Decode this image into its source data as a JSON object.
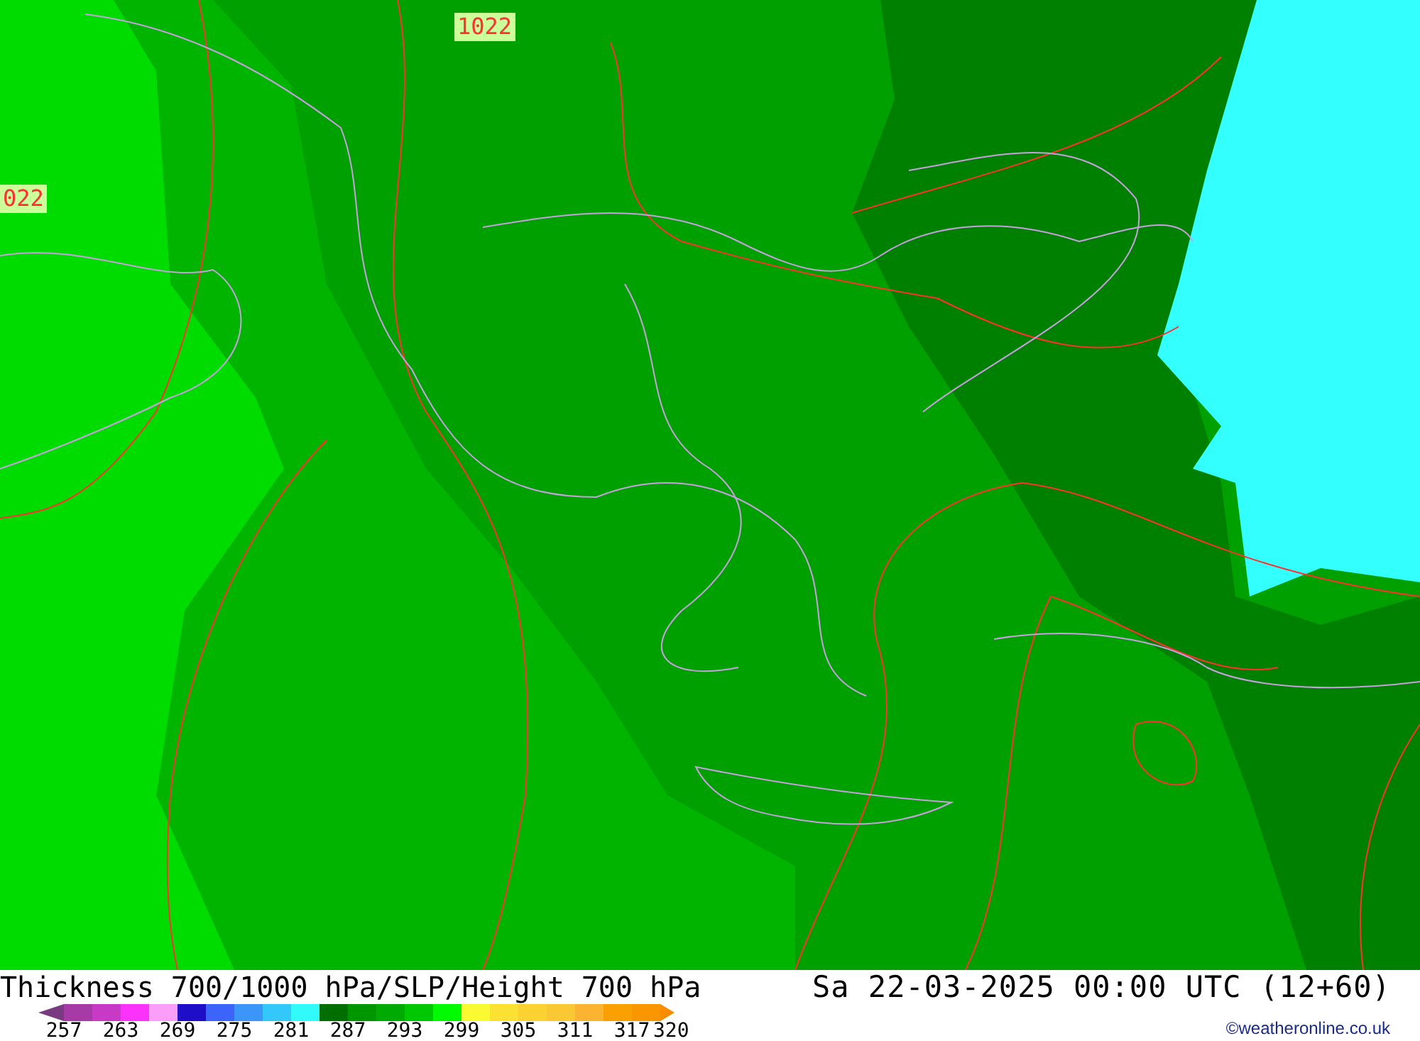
{
  "map": {
    "labels": [
      "1022",
      "022"
    ]
  },
  "title": "Thickness 700/1000 hPa/SLP/Height 700 hPa",
  "datetime": "Sa 22-03-2025 00:00 UTC (12+60)",
  "legend": {
    "swatches": [
      {
        "kind": "arrow_low",
        "color": "#7a3a82"
      },
      {
        "kind": "box",
        "color": "#a63aa6"
      },
      {
        "kind": "box",
        "color": "#c63ac6"
      },
      {
        "kind": "box",
        "color": "#fa32fa"
      },
      {
        "kind": "box",
        "color": "#fa9efa"
      },
      {
        "kind": "box",
        "color": "#1e0ec8"
      },
      {
        "kind": "box",
        "color": "#3c64fa"
      },
      {
        "kind": "box",
        "color": "#3c96fa"
      },
      {
        "kind": "box",
        "color": "#32c8fa"
      },
      {
        "kind": "box",
        "color": "#32fafa"
      },
      {
        "kind": "box",
        "color": "#006e00"
      },
      {
        "kind": "box",
        "color": "#009600"
      },
      {
        "kind": "box",
        "color": "#00aa00"
      },
      {
        "kind": "box",
        "color": "#00c800"
      },
      {
        "kind": "box",
        "color": "#00fa00"
      },
      {
        "kind": "box",
        "color": "#fafa32"
      },
      {
        "kind": "box",
        "color": "#fae132"
      },
      {
        "kind": "box",
        "color": "#fad232"
      },
      {
        "kind": "box",
        "color": "#fac832"
      },
      {
        "kind": "box",
        "color": "#fab432"
      },
      {
        "kind": "box",
        "color": "#faa000"
      },
      {
        "kind": "box",
        "color": "#fa9600"
      },
      {
        "kind": "arrow_high",
        "color": "#fa8c00"
      }
    ],
    "ticks": [
      "257",
      "263",
      "269",
      "275",
      "281",
      "287",
      "293",
      "299",
      "305",
      "311",
      "317",
      "320"
    ]
  },
  "credit": "©weatheronline.co.uk"
}
